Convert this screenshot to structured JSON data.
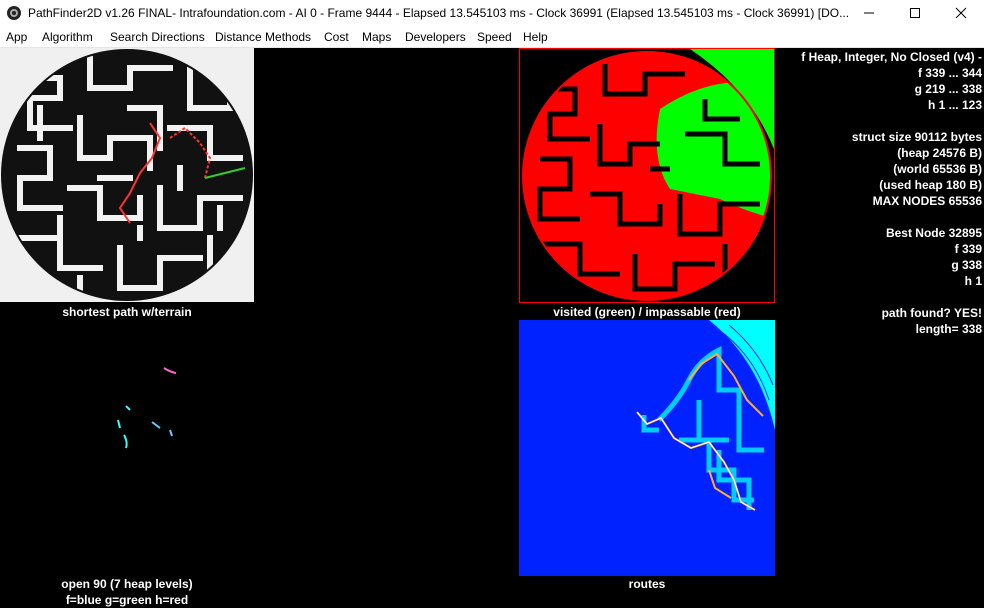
{
  "window": {
    "title": "PathFinder2D v1.26 FINAL- Intrafoundation.com   -  AI 0   -  Frame 9444   -  Elapsed 13.545103 ms   -  Clock 36991 (Elapsed 13.545103 ms  -  Clock 36991)   [DO..."
  },
  "menu": [
    "App",
    "Algorithm",
    "Search Directions",
    "Distance Methods",
    "Cost",
    "Maps",
    "Developers",
    "Speed",
    "Help"
  ],
  "captions": {
    "maze": "shortest path w/terrain",
    "visited": "visited (green) / impassable (red)",
    "open_line1": "open 90 (7 heap levels)",
    "open_line2": "f=blue g=green h=red",
    "routes": "routes"
  },
  "stats": [
    "f Heap, Integer, No Closed (v4) -",
    "f 339 ... 344",
    "g 219 ... 338",
    "h 1 ... 123",
    "",
    "struct size 90112 bytes",
    "(heap 24576 B)",
    "(world 65536 B)",
    "(used heap 180 B)",
    "MAX NODES 65536",
    "",
    "Best Node 32895",
    "f 339",
    "g 338",
    "h 1",
    "",
    "path found? YES!",
    "length= 338"
  ],
  "colors": {
    "visited": "#00ff00",
    "impassable": "#ff0000",
    "routes_bg": "#0022ff",
    "routes_corner": "#00ffff"
  },
  "icons": [
    "app-icon",
    "minimize-icon",
    "maximize-icon",
    "close-icon"
  ]
}
